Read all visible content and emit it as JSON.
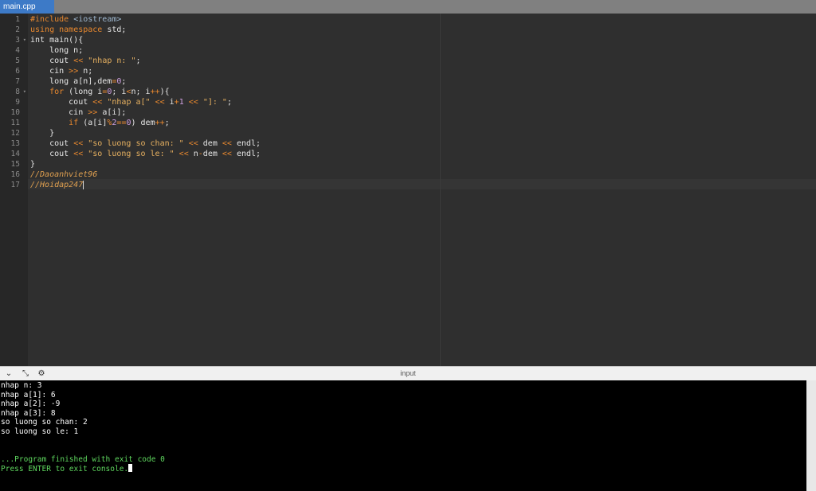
{
  "tab": {
    "label": "main.cpp"
  },
  "editor": {
    "lines": [
      [
        [
          "pre",
          "#include "
        ],
        [
          "inc",
          "<iostream>"
        ]
      ],
      [
        [
          "k",
          "using"
        ],
        [
          "t",
          " "
        ],
        [
          "k",
          "namespace"
        ],
        [
          "t",
          " std;"
        ]
      ],
      [
        [
          "t",
          "int main(){"
        ]
      ],
      [
        [
          "t",
          "    long n;"
        ]
      ],
      [
        [
          "t",
          "    cout "
        ],
        [
          "o",
          "<<"
        ],
        [
          "t",
          " "
        ],
        [
          "s",
          "\"nhap n: \""
        ],
        [
          "t",
          ";"
        ]
      ],
      [
        [
          "t",
          "    cin "
        ],
        [
          "o",
          ">>"
        ],
        [
          "t",
          " n;"
        ]
      ],
      [
        [
          "t",
          "    long a[n],dem"
        ],
        [
          "o",
          "="
        ],
        [
          "n",
          "0"
        ],
        [
          "t",
          ";"
        ]
      ],
      [
        [
          "t",
          "    "
        ],
        [
          "k",
          "for"
        ],
        [
          "t",
          " (long i"
        ],
        [
          "o",
          "="
        ],
        [
          "n",
          "0"
        ],
        [
          "t",
          "; i"
        ],
        [
          "o",
          "<"
        ],
        [
          "t",
          "n; i"
        ],
        [
          "o",
          "++"
        ],
        [
          "t",
          "){"
        ]
      ],
      [
        [
          "t",
          "        cout "
        ],
        [
          "o",
          "<<"
        ],
        [
          "t",
          " "
        ],
        [
          "s",
          "\"nhap a[\""
        ],
        [
          "t",
          " "
        ],
        [
          "o",
          "<<"
        ],
        [
          "t",
          " i"
        ],
        [
          "o",
          "+"
        ],
        [
          "n",
          "1"
        ],
        [
          "t",
          " "
        ],
        [
          "o",
          "<<"
        ],
        [
          "t",
          " "
        ],
        [
          "s",
          "\"]: \""
        ],
        [
          "t",
          ";"
        ]
      ],
      [
        [
          "t",
          "        cin "
        ],
        [
          "o",
          ">>"
        ],
        [
          "t",
          " a[i];"
        ]
      ],
      [
        [
          "t",
          "        "
        ],
        [
          "k",
          "if"
        ],
        [
          "t",
          " (a[i]"
        ],
        [
          "o",
          "%"
        ],
        [
          "n",
          "2"
        ],
        [
          "o",
          "=="
        ],
        [
          "n",
          "0"
        ],
        [
          "t",
          ") dem"
        ],
        [
          "o",
          "++"
        ],
        [
          "t",
          ";"
        ]
      ],
      [
        [
          "t",
          "    }"
        ]
      ],
      [
        [
          "t",
          "    cout "
        ],
        [
          "o",
          "<<"
        ],
        [
          "t",
          " "
        ],
        [
          "s",
          "\"so luong so chan: \""
        ],
        [
          "t",
          " "
        ],
        [
          "o",
          "<<"
        ],
        [
          "t",
          " dem "
        ],
        [
          "o",
          "<<"
        ],
        [
          "t",
          " endl;"
        ]
      ],
      [
        [
          "t",
          "    cout "
        ],
        [
          "o",
          "<<"
        ],
        [
          "t",
          " "
        ],
        [
          "s",
          "\"so luong so le: \""
        ],
        [
          "t",
          " "
        ],
        [
          "o",
          "<<"
        ],
        [
          "t",
          " n"
        ],
        [
          "o",
          "-"
        ],
        [
          "t",
          "dem "
        ],
        [
          "o",
          "<<"
        ],
        [
          "t",
          " endl;"
        ]
      ],
      [
        [
          "t",
          "}"
        ]
      ],
      [
        [
          "c",
          "//Daoanhviet96"
        ]
      ],
      [
        [
          "c",
          "//Hoidap247"
        ]
      ]
    ],
    "line_numbers": [
      "1",
      "2",
      "3",
      "4",
      "5",
      "6",
      "7",
      "8",
      "9",
      "10",
      "11",
      "12",
      "13",
      "14",
      "15",
      "16",
      "17"
    ],
    "fold_lines": [
      3,
      8
    ]
  },
  "panel": {
    "title": "input",
    "icons": [
      "chevron-down-icon",
      "expand-icon",
      "settings-icon"
    ]
  },
  "console": {
    "output_lines": [
      "nhap n: 3",
      "nhap a[1]: 6",
      "nhap a[2]: -9",
      "nhap a[3]: 8",
      "so luong so chan: 2",
      "so luong so le: 1",
      "",
      "",
      "...Program finished with exit code 0",
      "Press ENTER to exit console."
    ],
    "status_color": "#5fd85f"
  }
}
